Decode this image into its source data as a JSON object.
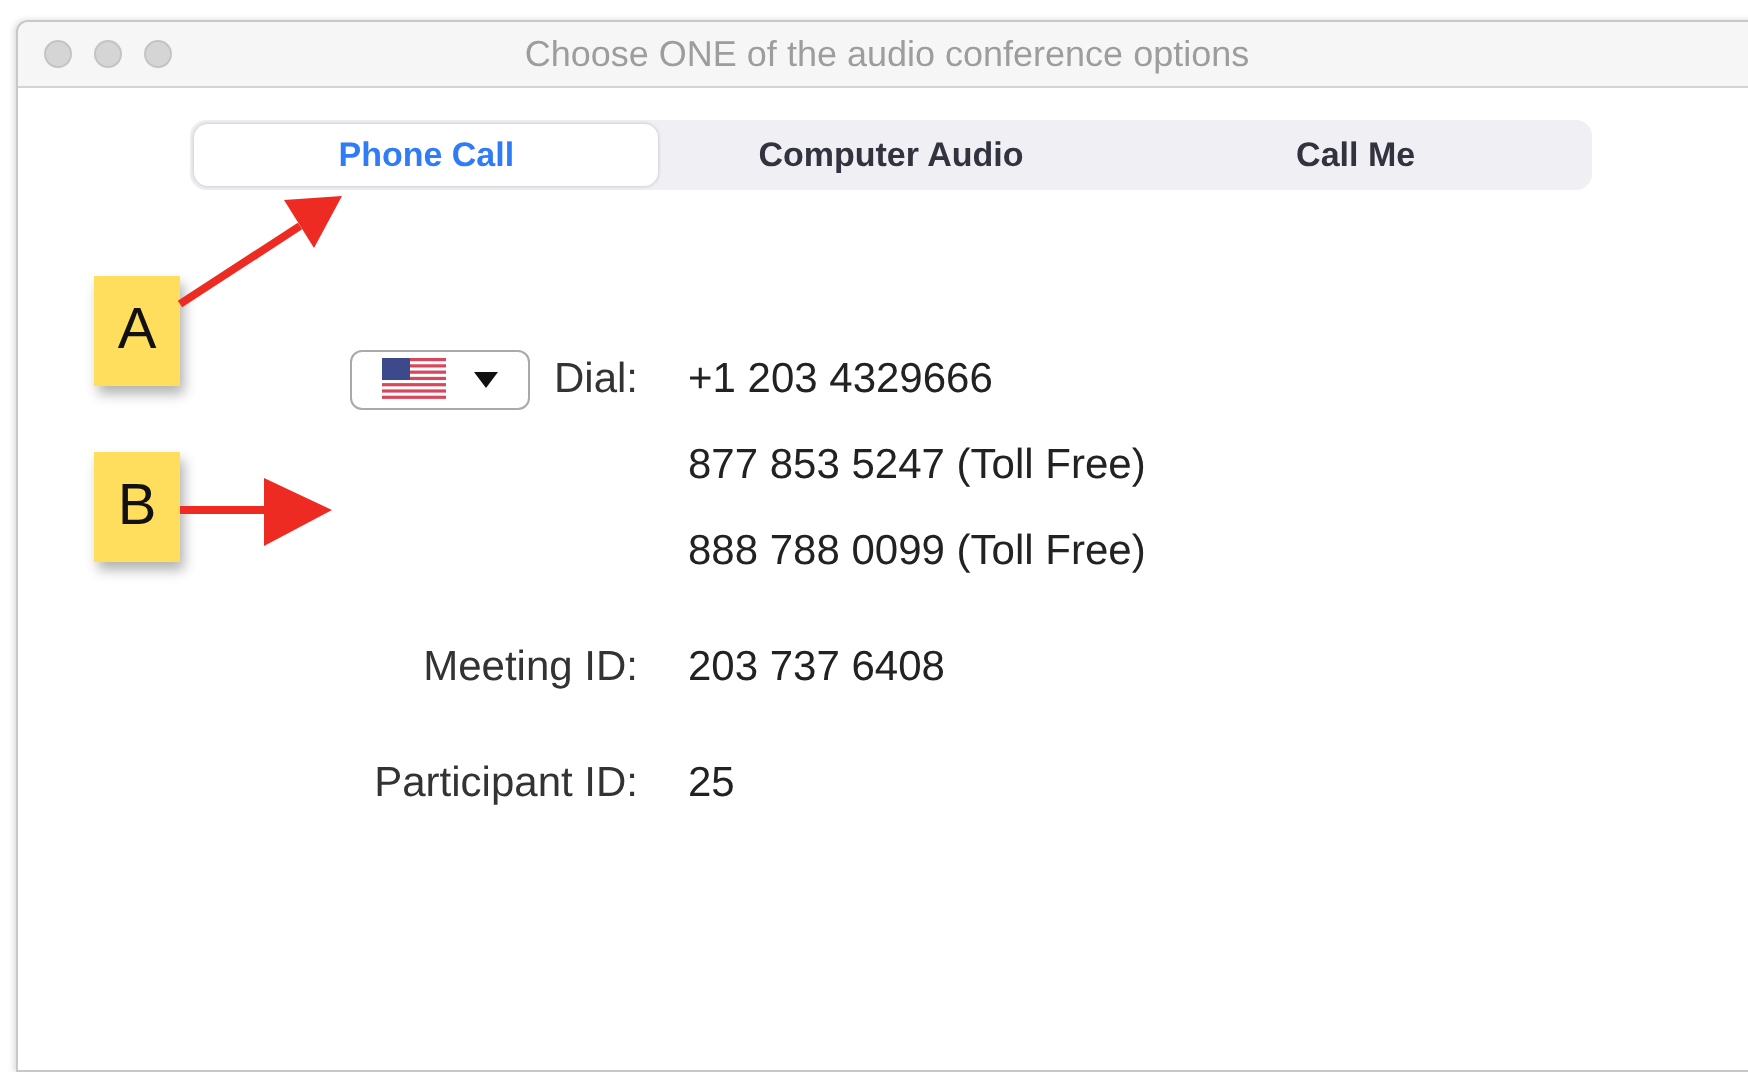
{
  "window": {
    "title": "Choose ONE of the audio conference options"
  },
  "tabs": [
    {
      "label": "Phone Call",
      "selected": true
    },
    {
      "label": "Computer Audio",
      "selected": false
    },
    {
      "label": "Call Me",
      "selected": false
    }
  ],
  "dial": {
    "label": "Dial:",
    "numbers": [
      "+1 203 4329666",
      "877 853 5247 (Toll Free)",
      "888 788 0099 (Toll Free)"
    ]
  },
  "details": [
    {
      "label": "Meeting ID:",
      "value": "203 737 6408"
    },
    {
      "label": "Participant ID:",
      "value": "25"
    }
  ],
  "callouts": [
    {
      "label": "A"
    },
    {
      "label": "B"
    }
  ]
}
